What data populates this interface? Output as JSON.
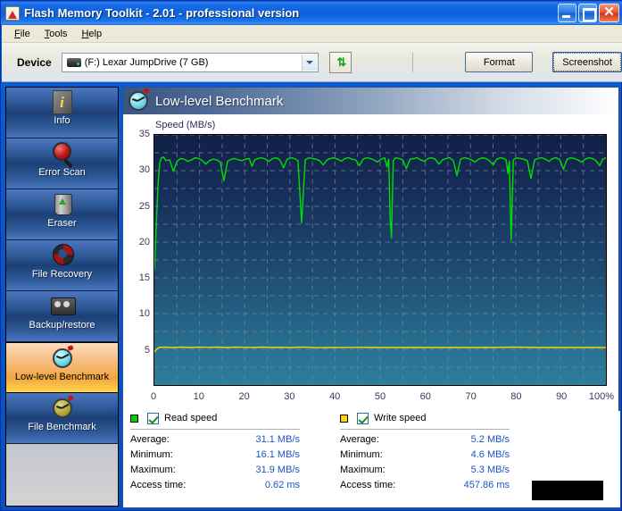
{
  "window": {
    "title": "Flash Memory Toolkit - 2.01 - professional version",
    "app_icon": "flash-memory-toolkit-icon",
    "buttons": {
      "minimize": "minimize-icon",
      "maximize": "maximize-icon",
      "close": "✕"
    }
  },
  "menubar": {
    "items": [
      {
        "label": "File",
        "accel": "F",
        "rest": "ile"
      },
      {
        "label": "Tools",
        "accel": "T",
        "rest": "ools"
      },
      {
        "label": "Help",
        "accel": "H",
        "rest": "elp"
      }
    ]
  },
  "toolbar": {
    "device_label": "Device",
    "device_value": "(F:) Lexar   JumpDrive (7 GB)",
    "device_icon": "usb-drive-icon",
    "refresh_label": "⇅",
    "format_label": "Format",
    "screenshot_label": "Screenshot"
  },
  "sidebar": {
    "items": [
      {
        "label": "Info",
        "icon": "info-icon",
        "selected": false
      },
      {
        "label": "Error Scan",
        "icon": "magnifier-icon",
        "selected": false
      },
      {
        "label": "Eraser",
        "icon": "trash-recycle-icon",
        "selected": false
      },
      {
        "label": "File Recovery",
        "icon": "lifebuoy-icon",
        "selected": false
      },
      {
        "label": "Backup/restore",
        "icon": "tape-cassette-icon",
        "selected": false
      },
      {
        "label": "Low-level Benchmark",
        "icon": "stopwatch-blue-icon",
        "selected": true
      },
      {
        "label": "File Benchmark",
        "icon": "stopwatch-olive-icon",
        "selected": false
      }
    ]
  },
  "content": {
    "title": "Low-level Benchmark",
    "title_icon": "stopwatch-blue-icon"
  },
  "legend": {
    "read": {
      "label": "Read speed",
      "color": "#00d000",
      "checked": true
    },
    "write": {
      "label": "Write speed",
      "color": "#ffd400",
      "checked": true
    }
  },
  "stats": {
    "read": {
      "rows": [
        {
          "key": "Average:",
          "value": "31.1 MB/s"
        },
        {
          "key": "Minimum:",
          "value": "16.1 MB/s"
        },
        {
          "key": "Maximum:",
          "value": "31.9 MB/s"
        },
        {
          "key": "Access time:",
          "value": "0.62 ms"
        }
      ]
    },
    "write": {
      "rows": [
        {
          "key": "Average:",
          "value": "5.2 MB/s"
        },
        {
          "key": "Minimum:",
          "value": "4.6 MB/s"
        },
        {
          "key": "Maximum:",
          "value": "5.3 MB/s"
        },
        {
          "key": "Access time:",
          "value": "457.86 ms"
        }
      ]
    }
  },
  "chart_data": {
    "type": "line",
    "title": "Low-level Benchmark",
    "xlabel": "",
    "ylabel": "Speed (MB/s)",
    "ylim": [
      0,
      35
    ],
    "xlim": [
      0,
      100
    ],
    "yticks": [
      35,
      30,
      25,
      20,
      15,
      10,
      5
    ],
    "xticks": [
      "0",
      "10",
      "20",
      "30",
      "40",
      "50",
      "60",
      "70",
      "80",
      "90",
      "100%"
    ],
    "grid": true,
    "legend_position": "below",
    "series": [
      {
        "name": "Read speed",
        "color": "#00e000",
        "x": [
          0.0,
          0.4,
          0.8,
          1.2,
          1.6,
          2.0,
          2.6,
          3.4,
          4.2,
          5.0,
          5.8,
          6.6,
          7.4,
          8.2,
          9.0,
          9.8,
          10.6,
          11.4,
          12.2,
          13.0,
          13.8,
          14.6,
          15.4,
          16.2,
          17.0,
          17.8,
          18.6,
          19.4,
          20.2,
          21.0,
          21.6,
          22.2,
          23.0,
          23.8,
          24.6,
          25.4,
          26.2,
          27.0,
          27.8,
          28.6,
          29.4,
          30.2,
          31.0,
          31.8,
          32.6,
          33.4,
          34.2,
          35.0,
          35.8,
          36.6,
          37.4,
          38.2,
          39.0,
          39.8,
          40.6,
          41.4,
          42.2,
          43.0,
          43.8,
          44.6,
          45.4,
          46.2,
          47.0,
          47.8,
          48.6,
          49.4,
          50.2,
          51.0,
          51.5,
          51.9,
          52.2,
          52.5,
          52.9,
          53.4,
          54.2,
          55.0,
          55.8,
          56.6,
          57.4,
          58.2,
          59.0,
          59.8,
          60.6,
          61.4,
          62.2,
          63.0,
          63.8,
          64.6,
          65.4,
          66.2,
          67.0,
          67.8,
          68.6,
          69.4,
          70.2,
          71.0,
          71.8,
          72.6,
          73.4,
          74.2,
          75.0,
          75.8,
          76.6,
          77.4,
          77.9,
          78.3,
          78.6,
          79.0,
          79.5,
          80.2,
          81.0,
          81.8,
          82.6,
          83.4,
          84.2,
          85.0,
          85.8,
          86.6,
          87.4,
          88.2,
          89.0,
          89.8,
          90.6,
          91.4,
          92.2,
          93.0,
          93.8,
          94.6,
          95.4,
          96.2,
          97.0,
          97.8,
          98.6,
          99.3,
          100.0
        ],
        "y": [
          16.1,
          22.0,
          28.0,
          31.2,
          31.8,
          31.9,
          31.4,
          31.5,
          29.9,
          31.3,
          31.7,
          31.6,
          31.3,
          31.5,
          31.8,
          31.7,
          31.4,
          30.9,
          31.4,
          31.6,
          31.5,
          31.2,
          28.6,
          31.3,
          31.6,
          31.7,
          31.5,
          31.4,
          31.6,
          31.7,
          30.6,
          31.5,
          31.7,
          31.8,
          31.6,
          31.3,
          31.7,
          31.8,
          31.5,
          30.4,
          31.6,
          31.8,
          31.7,
          31.4,
          22.7,
          31.5,
          31.8,
          31.7,
          31.6,
          31.4,
          30.8,
          31.5,
          31.7,
          31.8,
          31.6,
          31.3,
          31.7,
          31.8,
          31.6,
          31.5,
          30.7,
          31.6,
          31.8,
          31.7,
          31.5,
          31.2,
          31.6,
          31.8,
          30.5,
          31.6,
          23.5,
          20.6,
          31.4,
          31.8,
          31.7,
          31.5,
          30.3,
          31.6,
          31.7,
          31.8,
          31.5,
          31.3,
          31.7,
          31.8,
          31.6,
          30.9,
          31.5,
          31.7,
          31.8,
          31.4,
          29.3,
          31.6,
          31.8,
          31.7,
          31.5,
          31.2,
          31.6,
          31.8,
          31.7,
          31.4,
          30.8,
          31.6,
          31.8,
          31.7,
          31.5,
          29.6,
          31.3,
          20.3,
          31.5,
          31.8,
          31.7,
          31.6,
          31.4,
          28.9,
          31.5,
          31.7,
          31.8,
          31.6,
          31.3,
          31.7,
          31.8,
          31.5,
          30.2,
          31.6,
          31.8,
          31.7,
          31.5,
          31.2,
          31.6,
          31.8,
          31.7,
          31.4,
          30.7,
          31.6,
          31.8,
          31.5
        ]
      },
      {
        "name": "Write speed",
        "color": "#ffd400",
        "x": [
          0.0,
          0.5,
          1.0,
          2.0,
          4.0,
          6.0,
          8.0,
          10.0,
          12.0,
          14.0,
          16.0,
          18.0,
          20.0,
          22.0,
          24.0,
          26.0,
          28.0,
          30.0,
          33.0,
          36.0,
          40.0,
          45.0,
          50.0,
          55.0,
          60.0,
          65.0,
          70.0,
          75.0,
          80.0,
          85.0,
          90.0,
          95.0,
          100.0
        ],
        "y": [
          4.6,
          5.0,
          5.25,
          5.3,
          5.25,
          5.3,
          5.25,
          5.3,
          5.28,
          5.3,
          5.25,
          5.3,
          5.28,
          5.25,
          5.3,
          5.25,
          5.28,
          5.25,
          5.3,
          5.22,
          5.25,
          5.28,
          5.25,
          5.25,
          5.25,
          5.25,
          5.25,
          5.25,
          5.3,
          5.25,
          5.25,
          5.25,
          5.25
        ]
      }
    ]
  }
}
